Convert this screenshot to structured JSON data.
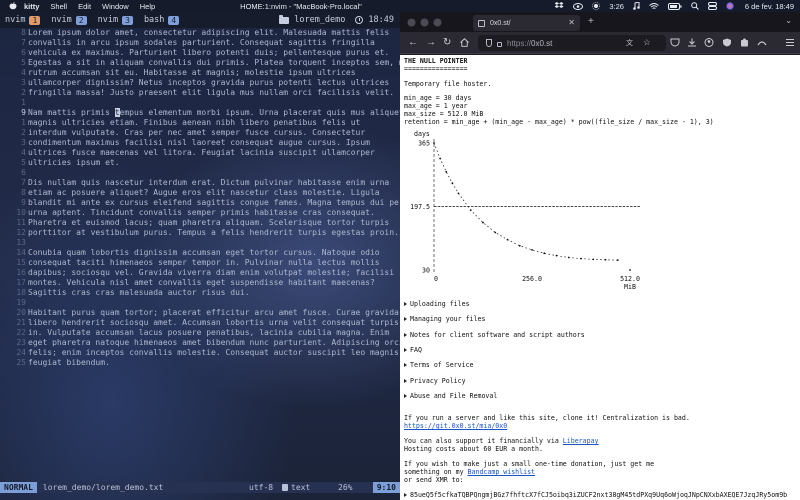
{
  "menubar": {
    "app": "kitty",
    "items": [
      "Shell",
      "Edit",
      "Window",
      "Help"
    ],
    "window_title": "HOME:1:nvim - \"MacBook-Pro.local\"",
    "time": "3:26",
    "date": "6 de fev. 18:49",
    "icons": [
      "apple-icon",
      "dropbox-icon",
      "eye-icon",
      "brightness-icon",
      "music-icon",
      "wifi-icon",
      "battery-icon",
      "search-icon",
      "control-center-icon",
      "siri-icon"
    ]
  },
  "terminal": {
    "tabs": [
      {
        "name": "nvim",
        "num": "1",
        "color": "#e39a64"
      },
      {
        "name": "nvim",
        "num": "2",
        "color": "#7f9fda"
      },
      {
        "name": "nvim",
        "num": "3",
        "color": "#7f9fda"
      },
      {
        "name": "bash",
        "num": "4",
        "color": "#7f9fda"
      }
    ],
    "session": "lorem_demo",
    "clock": "18:49",
    "lines": [
      {
        "n": "8",
        "t": "Lorem ipsum dolor amet, consectetur adipiscing elit. Malesuada mattis felis"
      },
      {
        "n": "7",
        "t": "convallis in arcu ipsum sodales parturient. Consequat sagittis fringilla"
      },
      {
        "n": "6",
        "t": "vehicula ex maximus. Parturient libero potenti duis; pellentesque purus et."
      },
      {
        "n": "5",
        "t": "Egestas a sit in aliquam convallis dui primis. Platea torquent inceptos sem, m"
      },
      {
        "n": "4",
        "t": "rutrum accumsan sit eu. Habitasse at magnis; molestie ipsum ultrices"
      },
      {
        "n": "3",
        "t": "ullamcorper dignissim? Netus inceptos gravida purus potenti lectus ultrices"
      },
      {
        "n": "2",
        "t": "fringilla massa! Justo praesent elit ligula mus nullam orci facilisis velit."
      },
      {
        "n": "1",
        "t": ""
      },
      {
        "n": "9",
        "t": "Nam mattis primis tempus elementum morbi ipsum. Urna placerat quis mus aliquet",
        "current": true
      },
      {
        "n": "1",
        "t": "magnis ultricies etiam. Finibus aenean nibh libero penatibus felis ut"
      },
      {
        "n": "2",
        "t": "interdum vulputate. Cras per nec amet semper fusce cursus. Consectetur"
      },
      {
        "n": "3",
        "t": "condimentum maximus facilisi nisl laoreet consequat augue cursus. Ipsum"
      },
      {
        "n": "4",
        "t": "ultrices fusce maecenas vel litora. Feugiat lacinia suscipit ullamcorper"
      },
      {
        "n": "5",
        "t": "ultricies ipsum et."
      },
      {
        "n": "6",
        "t": ""
      },
      {
        "n": "7",
        "t": "Dis nullam quis nascetur interdum erat. Dictum pulvinar habitasse enim urna"
      },
      {
        "n": "8",
        "t": "etiam ac posuere aliquet? Augue eros elit nascetur class molestie. Ligula"
      },
      {
        "n": "9",
        "t": "blandit mi ante ex cursus eleifend sagittis congue fames. Magna tempus dui per"
      },
      {
        "n": "10",
        "t": "urna aptent. Tincidunt convallis semper primis habitasse cras consequat."
      },
      {
        "n": "11",
        "t": "Pharetra et euismod lacus; quam pharetra aliquam. Scelerisque tortor turpis"
      },
      {
        "n": "12",
        "t": "porttitor at vestibulum purus. Tempus a felis hendrerit turpis egestas proin."
      },
      {
        "n": "13",
        "t": ""
      },
      {
        "n": "14",
        "t": "Conubia quam lobortis dignissim accumsan eget tortor cursus. Natoque odio"
      },
      {
        "n": "15",
        "t": "consequat taciti himenaeos semper tempor in. Pulvinar nulla lectus mollis"
      },
      {
        "n": "16",
        "t": "dapibus; sociosqu vel. Gravida viverra diam enim volutpat molestie; facilisi"
      },
      {
        "n": "17",
        "t": "montes. Vehicula nisl amet convallis eget suspendisse habitant maecenas?"
      },
      {
        "n": "18",
        "t": "Sagittis cras cras malesuada auctor risus dui."
      },
      {
        "n": "19",
        "t": ""
      },
      {
        "n": "20",
        "t": "Habitant purus quam tortor; placerat efficitur arcu amet fusce. Curae gravida"
      },
      {
        "n": "21",
        "t": "libero hendrerit sociosqu amet. Accumsan lobortis urna velit consequat turpis"
      },
      {
        "n": "22",
        "t": "in. Vulputate accumsan lacus posuere penatibus, lacinia cubilia magna. Enim"
      },
      {
        "n": "23",
        "t": "eget pharetra natoque himenaeos amet bibendum nunc parturient. Adipiscing orci"
      },
      {
        "n": "24",
        "t": "felis; enim inceptos convallis molestie. Consequat auctor suscipit leo magnis"
      },
      {
        "n": "25",
        "t": "feugiat bibendum."
      }
    ],
    "status": {
      "mode": "NORMAL",
      "file": "lorem_demo/lorem_demo.txt",
      "encoding": "utf-8",
      "filetype": "text",
      "percent": "26%",
      "position": "9:10"
    }
  },
  "browser": {
    "tab_title": "0x0.st/",
    "url_prefix": "https://",
    "url_domain": "0x0.st",
    "page": {
      "heading": "THE NULL POINTER",
      "underline": "================",
      "subtitle": "Temporary file hoster.",
      "params": [
        "min_age = 30 days",
        "max_age = 1 year",
        "max_size = 512.0 MiB",
        "retention = min_age + (min_age - max_age) * pow((file_size / max_size - 1), 3)"
      ],
      "sections": [
        "Uploading files",
        "Managing your files",
        "Notes for client software and script authors",
        "FAQ",
        "Terms of Service",
        "Privacy Policy",
        "Abuse and File Removal"
      ],
      "footer": {
        "clone_text": "If you run a server and like this site, clone it! Centralization is bad.",
        "git_link": "https://git.0x0.st/mia/0x0",
        "support_text": "You can also support it financially via ",
        "support_link": "Liberapay",
        "hosting_cost": "Hosting costs about 60 EUR a month.",
        "donate_1": "If you wish to make just a small one-time donation, just get me",
        "donate_2_pre": "something on my ",
        "wishlist_link": "Bandcamp wishlist",
        "donate_3": "or send XMR to:",
        "xmr": "85ueQ5f5cfkaTQBPQngmjBGz7fhftcX7fCJ5oibq3iZUCF2nxt38gM45tdPXq9Uq6oWjoqJNpCNXxbAXEQE7JzqJRy5om9b"
      }
    },
    "chart_data": {
      "type": "line",
      "title": "",
      "ylabel": "days",
      "xlabel": "MiB",
      "yticks": [
        "365",
        "197.5",
        "30"
      ],
      "xticks": [
        "0",
        "256.0",
        "512.0"
      ],
      "ylim": [
        30,
        365
      ],
      "xlim": [
        0,
        512
      ],
      "x": [
        0,
        16,
        32,
        48,
        64,
        96,
        128,
        160,
        192,
        224,
        256,
        288,
        320,
        352,
        384,
        416,
        448,
        480,
        512
      ],
      "y": [
        365,
        324,
        289,
        259,
        232,
        188,
        155,
        129,
        110,
        94,
        83,
        74,
        68,
        63,
        60,
        58,
        57,
        56,
        30
      ]
    }
  }
}
